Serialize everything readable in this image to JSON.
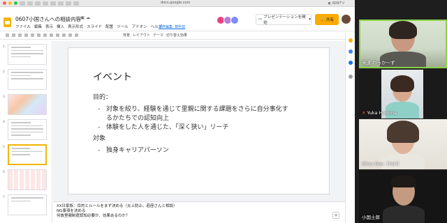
{
  "browser": {
    "url": "docs.google.com",
    "tab_indicator": "◐ 6097ツ"
  },
  "app": {
    "doc_title": "0607小国さんへの相談内容",
    "menu": [
      "ファイル",
      "編集",
      "表示",
      "挿入",
      "表示形式",
      "スライド",
      "配置",
      "ツール",
      "アドオン",
      "ヘルプ"
    ],
    "last_edit": "最終編集: 数秒前",
    "present_label": "プレゼンテーションを開始",
    "share_label": "共有",
    "toolbar": [
      "背景",
      "レイアウト",
      "テーマ",
      "切り替え効果"
    ],
    "accent_color": "#f4b400"
  },
  "filmstrip": {
    "slides": [
      "1",
      "2",
      "3",
      "4",
      "5",
      "6",
      "7"
    ],
    "active_slide": "5"
  },
  "slide": {
    "heading": "イベント",
    "goal_label": "目的：",
    "bullet_mark": "-",
    "goal_bullet_1a": "対象を絞り、経験を通じて里親に関する課題をさらに自分事化す",
    "goal_bullet_1b": "るかたちでの認知向上",
    "goal_bullet_2": "体験をした人を通じた、「深く狭い」リーチ",
    "target_label": "対象",
    "target_bullet_1": "独身キャリアパーソン"
  },
  "notes": {
    "line1": "XX日家族：目的とルールをまず決める（炎上防止、若座さんと相談）",
    "line2": "NG事項を決める",
    "line3": "何故里親制度認知必要か、効果あるのか？"
  },
  "participants": [
    {
      "name": "英道 わっか〜ず",
      "speaking": true
    },
    {
      "name": "Yuka Homma",
      "muted": true
    },
    {
      "name": "Shou Gou（Yuki）"
    },
    {
      "name": "小国士郎"
    }
  ]
}
